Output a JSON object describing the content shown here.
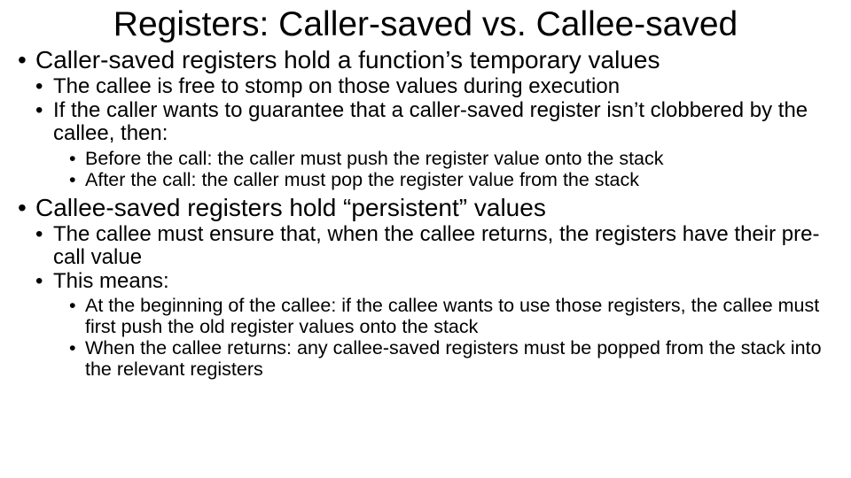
{
  "title": "Registers: Caller-saved vs. Callee-saved",
  "bullets": {
    "p1": "Caller-saved registers hold a function’s temporary values",
    "p1a": "The callee is free to stomp on those values during execution",
    "p1b": "If the caller wants to guarantee that a caller-saved register isn’t clobbered by the callee, then:",
    "p1b1": "Before the call: the caller must push the register value onto the stack",
    "p1b2": "After the call: the caller must pop the register value from the stack",
    "p2": "Callee-saved registers hold “persistent” values",
    "p2a": "The callee must ensure that, when the callee returns, the registers have their pre-call value",
    "p2b": "This means:",
    "p2b1": "At the beginning of the callee: if the callee wants to use those registers, the callee must first push the old register values onto the stack",
    "p2b2": "When the callee returns: any callee-saved registers must be popped from the stack into the relevant registers"
  }
}
